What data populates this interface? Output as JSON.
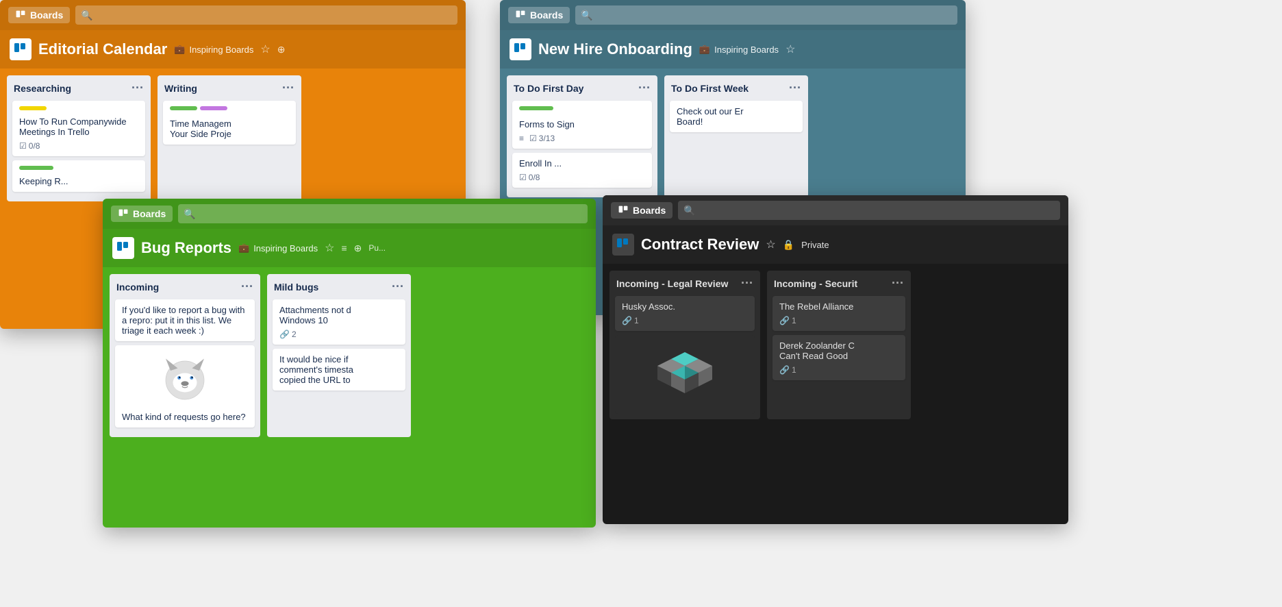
{
  "windows": {
    "editorial": {
      "header_btn": "Boards",
      "search_placeholder": "Search",
      "title": "Editorial Calendar",
      "workspace": "Inspiring Boards",
      "accent_color": "#e8830a",
      "lists": [
        {
          "name": "Researching",
          "cards": [
            {
              "labels": [
                "yellow"
              ],
              "text": "How To Run Companywide Meetings In Trello",
              "footer": "0/8"
            },
            {
              "labels": [
                "green"
              ],
              "text": "Keeping R..."
            }
          ]
        },
        {
          "name": "Writing",
          "cards": [
            {
              "labels": [
                "green",
                "purple"
              ],
              "text": "Time Managem Your Side Proje"
            }
          ]
        }
      ]
    },
    "newhire": {
      "header_btn": "Boards",
      "search_placeholder": "Search",
      "title": "New Hire Onboarding",
      "workspace": "Inspiring Boards",
      "accent_color": "#4a7d8e",
      "lists": [
        {
          "name": "To Do First Day",
          "cards": [
            {
              "labels": [
                "green"
              ],
              "text": "Forms to Sign",
              "footer": "3/13"
            },
            {
              "text": "Enroll In ...",
              "footer": "0/8"
            }
          ]
        },
        {
          "name": "To Do First Week",
          "cards": [
            {
              "text": "Check out our Er Board!"
            }
          ]
        }
      ]
    },
    "bugs": {
      "header_btn": "Boards",
      "search_placeholder": "Search",
      "title": "Bug Reports",
      "workspace": "Inspiring Boards",
      "accent_color": "#4caf1e",
      "lists": [
        {
          "name": "Incoming",
          "cards": [
            {
              "text": "If you'd like to report a bug with a repro: put it in this list. We triage it each week :)"
            },
            {
              "text": "What kind of requests go here?"
            }
          ]
        },
        {
          "name": "Mild bugs",
          "cards": [
            {
              "text": "Attachments not d Windows 10",
              "attachments": "2"
            },
            {
              "text": "It would be nice if comment's timesta copied the URL to"
            }
          ]
        }
      ]
    },
    "contract": {
      "header_btn": "Boards",
      "search_placeholder": "Search",
      "title": "Contract Review",
      "privacy": "Private",
      "accent_color": "#1a1a1a",
      "lists": [
        {
          "name": "Incoming - Legal Review",
          "cards": [
            {
              "text": "Husky Assoc.",
              "attachments": "1"
            }
          ]
        },
        {
          "name": "Incoming - Securit",
          "cards": [
            {
              "text": "The Rebel Alliance",
              "attachments": "1"
            },
            {
              "text": "Derek Zoolander C Can't Read Good",
              "attachments": "1"
            }
          ]
        }
      ]
    }
  },
  "icons": {
    "trello_board": "▣",
    "search": "🔍",
    "star": "☆",
    "globe": "⊕",
    "lock": "🔒",
    "menu": "≡",
    "dots": "···",
    "checklist": "☑",
    "attachment": "🔗",
    "briefcase": "💼"
  }
}
